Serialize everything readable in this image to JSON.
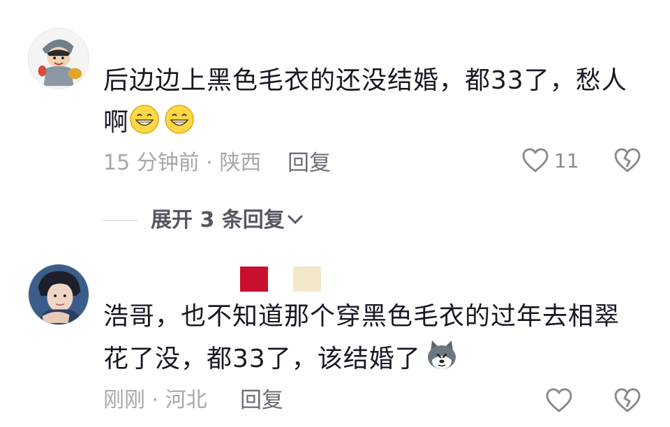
{
  "comments": [
    {
      "text_line1": "后边边上黑色毛衣的还没结婚，都33了，愁人",
      "text_line2": "啊",
      "emojis": [
        "grin-emoji",
        "grin-emoji"
      ],
      "meta": "15 分钟前 · 陕西",
      "reply_label": "回复",
      "like_count": "11",
      "avatar": "cartoon-avatar"
    },
    {
      "text_line1": "浩哥，也不知道那个穿黑色毛衣的过年去相翠",
      "text_line2": "花了没，都33了，该结婚了",
      "emojis": [
        "husky-emoji"
      ],
      "meta": "刚刚 · 河北",
      "reply_label": "回复",
      "like_count": "",
      "avatar": "portrait-avatar"
    }
  ],
  "expand_replies": "展开 3 条回复",
  "colors": {
    "text": "#161823",
    "meta": "#a7a7ab",
    "icon": "#8a8b91",
    "swatch_red": "#c8102e",
    "swatch_cream": "#f3e8c8"
  }
}
